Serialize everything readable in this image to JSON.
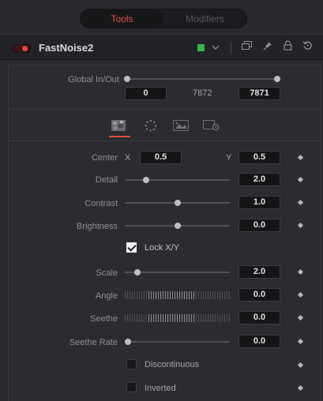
{
  "tabs": [
    {
      "label": "Tools",
      "active": true
    },
    {
      "label": "Modifiers",
      "active": false
    }
  ],
  "header": {
    "tool_name": "FastNoise2",
    "color_chip": "#39b54a",
    "icons": [
      "chevron-down-icon",
      "copy-icon",
      "pin-icon",
      "lock-icon",
      "reset-icon"
    ]
  },
  "global": {
    "label": "Global In/Out",
    "in_value": "0",
    "middle_value": "7872",
    "out_value": "7871"
  },
  "panel_tabs": [
    "noise-tab-icon",
    "color-tab-icon",
    "image-tab-icon",
    "settings-tab-icon"
  ],
  "controls": {
    "center": {
      "label": "Center",
      "x_label": "X",
      "x_value": "0.5",
      "y_label": "Y",
      "y_value": "0.5"
    },
    "detail": {
      "label": "Detail",
      "value": "2.0",
      "slider_fraction": 0.2
    },
    "contrast": {
      "label": "Contrast",
      "value": "1.0",
      "slider_fraction": 0.5
    },
    "brightness": {
      "label": "Brightness",
      "value": "0.0",
      "slider_fraction": 0.5
    },
    "lock_xy": {
      "label": "Lock X/Y",
      "checked": true
    },
    "scale": {
      "label": "Scale",
      "value": "2.0",
      "slider_fraction": 0.12
    },
    "angle": {
      "label": "Angle",
      "value": "0.0"
    },
    "seethe": {
      "label": "Seethe",
      "value": "0.0"
    },
    "seethe_rate": {
      "label": "Seethe Rate",
      "value": "0.0",
      "slider_fraction": 0.0
    },
    "discontinuous": {
      "label": "Discontinuous",
      "checked": false
    },
    "inverted": {
      "label": "Inverted",
      "checked": false
    }
  },
  "colors": {
    "accent": "#e0523e",
    "background": "#28282e"
  }
}
